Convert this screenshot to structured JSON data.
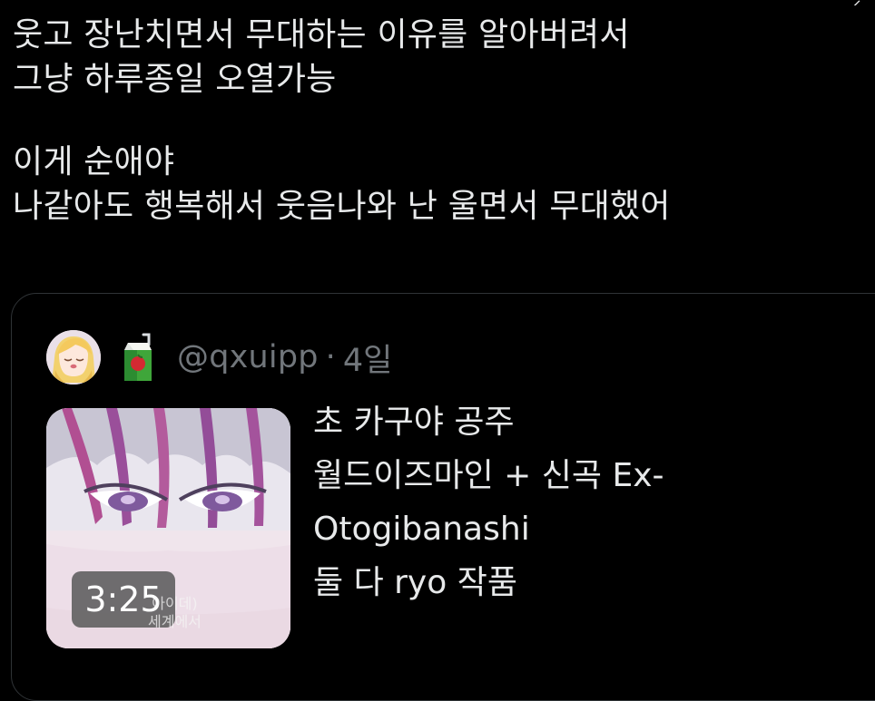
{
  "tweet": {
    "lines": [
      "웃고 장난치면서 무대하는 이유를 알아버려서",
      "그냥 하루종일 오열가능",
      "이게 순애야",
      "나같아도 행복해서 웃음나와 난 울면서 무대했어"
    ]
  },
  "quote": {
    "handle": "@qxuipp",
    "separator": "·",
    "time": "4일",
    "avatar_icon": "anime-avatar",
    "juice_icon": "apple-juice-box-emoji",
    "text_lines": [
      "초 카구야 공주",
      "월드이즈마인 + 신곡 Ex-",
      "Otogibanashi",
      "둘 다 ryo 작품"
    ],
    "media": {
      "duration": "3:25",
      "subtitle_lines": [
        "아이데)",
        "세계에서"
      ],
      "icon": "video-thumbnail"
    }
  },
  "colors": {
    "background": "#000000",
    "text_primary": "#e7e9ea",
    "text_secondary": "#71767b",
    "border": "#2f3336"
  }
}
